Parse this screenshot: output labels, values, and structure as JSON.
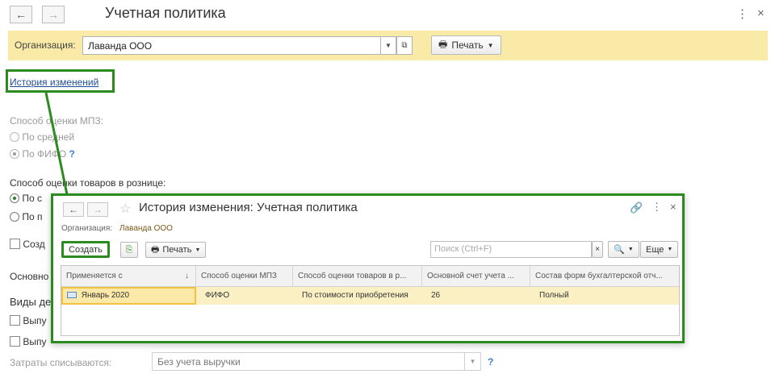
{
  "window": {
    "title": "Учетная политика",
    "back_icon": "←",
    "forward_icon": "→",
    "more_icon": "⋮",
    "close_icon": "×"
  },
  "org_bar": {
    "label": "Организация:",
    "value": "Лаванда ООО",
    "print_label": "Печать"
  },
  "history_link": "История изменений",
  "form": {
    "mpz_label": "Способ оценки МПЗ:",
    "mpz_options": [
      "По средней",
      "По ФИФО"
    ],
    "mpz_help": "?",
    "retail_label": "Способ оценки товаров в рознице:",
    "retail_options": [
      "По с",
      "По п"
    ],
    "create_checkbox_label": "Созд",
    "basic_label": "Основно",
    "types_label": "Виды де",
    "vyp1_label": "Выпу",
    "vyp2_label": "Выпу",
    "costs_label": "Затраты списываются:",
    "costs_value": "Без учета выручки",
    "costs_help": "?"
  },
  "modal": {
    "title": "История изменения: Учетная политика",
    "org_label": "Организация:",
    "org_value": "Лаванда ООО",
    "create_label": "Создать",
    "print_label": "Печать",
    "search_placeholder": "Поиск (Ctrl+F)",
    "more_label": "Еще",
    "columns": [
      "Применяется с",
      "Способ оценки МПЗ",
      "Способ оценки товаров в р...",
      "Основной счет учета ...",
      "Состав форм бухгалтерской отч..."
    ],
    "sort_indicator": "↓",
    "rows": [
      [
        "Январь 2020",
        "ФИФО",
        "По стоимости приобретения",
        "26",
        "Полный"
      ]
    ]
  },
  "colors": {
    "accent_green": "#2a8b1f",
    "org_bar_bg": "#faeaa8",
    "selected_row": "#fbf0c4",
    "link": "#1f4c99"
  }
}
